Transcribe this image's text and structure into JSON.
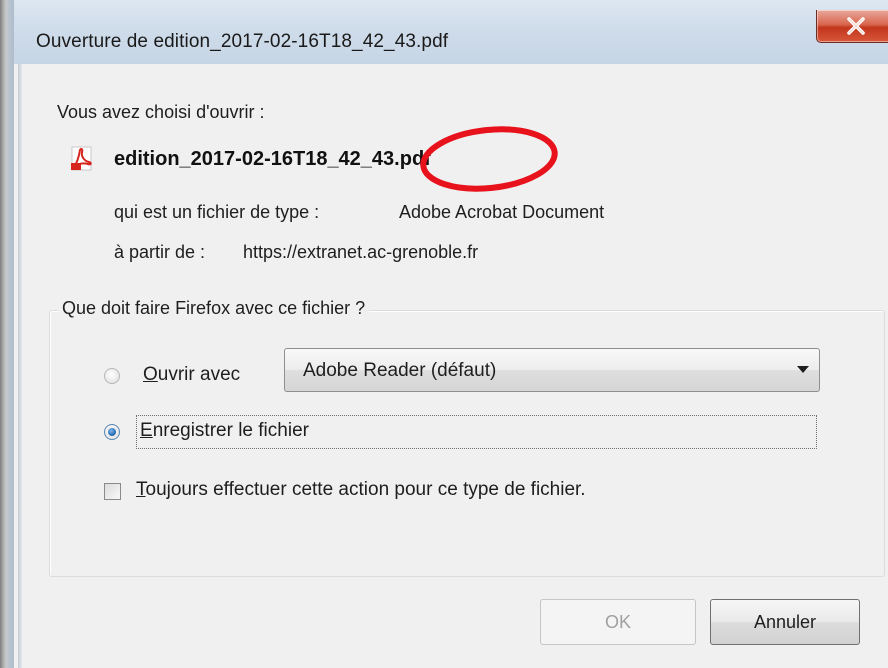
{
  "window": {
    "title": "Ouverture de edition_2017-02-16T18_42_43.pdf",
    "close_glyph": "x",
    "close_icon": "close-icon"
  },
  "content": {
    "intro": "Vous avez choisi d'ouvrir :",
    "file_icon": "pdf-file-icon",
    "filename": "edition_2017-02-16T18_42_43.pdf",
    "type_label": "qui est un fichier de type :",
    "type_value": "Adobe Acrobat Document",
    "from_label": "à partir de :",
    "from_value": "https://extranet.ac-grenoble.fr"
  },
  "action_group": {
    "legend": "Que doit faire Firefox avec ce fichier ?",
    "open_with": {
      "accel": "O",
      "rest": "uvrir avec",
      "selected": false
    },
    "app_select": {
      "value": "Adobe Reader  (défaut)"
    },
    "save_file": {
      "accel": "E",
      "rest": "nregistrer le fichier",
      "selected": true
    },
    "always_checkbox": {
      "accel": "T",
      "rest": "oujours effectuer cette action pour ce type de fichier.",
      "checked": false
    }
  },
  "buttons": {
    "ok": "OK",
    "cancel": "Annuler"
  },
  "colors": {
    "annotation_circle": "#e8121c",
    "pdf_icon": "#d6251d",
    "close_button": "#c9412a"
  }
}
